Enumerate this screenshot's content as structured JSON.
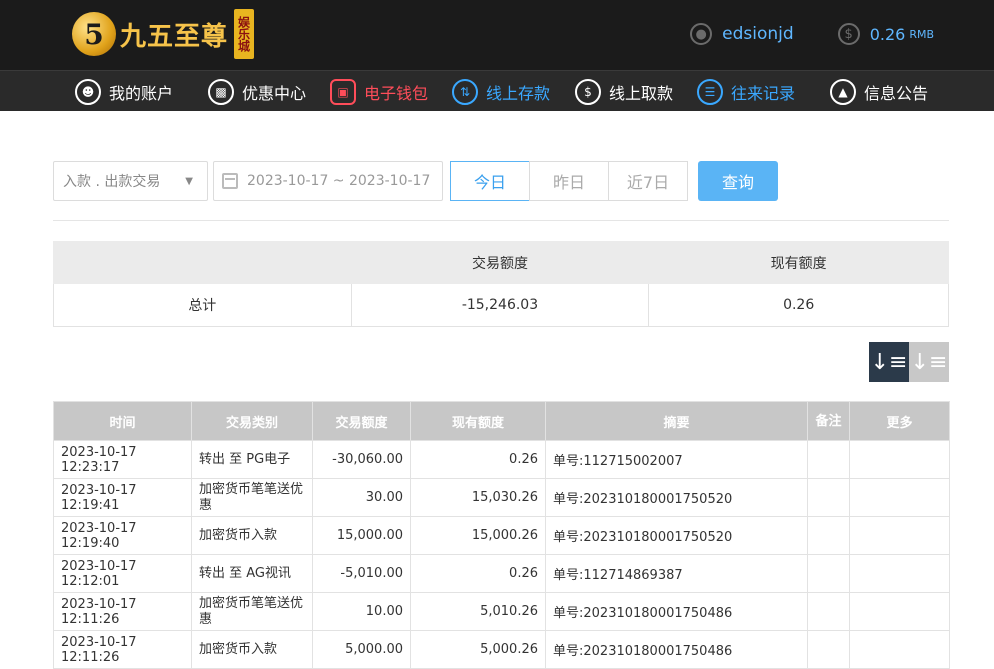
{
  "header": {
    "logo_text": "九五至尊",
    "logo_badge": "5",
    "logo_tag": "娱乐城",
    "username": "edsionjd",
    "balance": "0.26",
    "balance_unit": "RMB",
    "icons": {
      "user": "user-icon",
      "coin": "dollar-coin-icon"
    }
  },
  "nav": {
    "items": [
      {
        "label": "我的账户",
        "icon": "user-circle-icon"
      },
      {
        "label": "优惠中心",
        "icon": "gift-icon"
      },
      {
        "label": "电子钱包",
        "icon": "wallet-icon",
        "color": "#ff4d5a"
      },
      {
        "label": "线上存款",
        "icon": "deposit-icon",
        "color": "#3aa8ff"
      },
      {
        "label": "线上取款",
        "icon": "withdraw-icon"
      },
      {
        "label": "往来记录",
        "icon": "records-icon",
        "color": "#3aa8ff"
      },
      {
        "label": "信息公告",
        "icon": "bell-icon"
      }
    ]
  },
  "filters": {
    "type_select": "入款 . 出款交易",
    "date_range": "2023-10-17 ~ 2023-10-17",
    "today": "今日",
    "yesterday": "昨日",
    "last7": "近7日",
    "query": "查询"
  },
  "summary": {
    "headers": [
      "",
      "交易额度",
      "现有额度"
    ],
    "row": [
      "总计",
      "-15,246.03",
      "0.26"
    ]
  },
  "detail": {
    "headers": [
      "时间",
      "交易类别",
      "交易额度",
      "现有额度",
      "摘要",
      "备注",
      "更多"
    ],
    "rows": [
      [
        "2023-10-17 12:23:17",
        "转出 至 PG电子",
        "-30,060.00",
        "0.26",
        "单号:112715002007",
        "",
        ""
      ],
      [
        "2023-10-17 12:19:41",
        "加密货币笔笔送优惠",
        "30.00",
        "15,030.26",
        "单号:202310180001750520",
        "",
        ""
      ],
      [
        "2023-10-17 12:19:40",
        "加密货币入款",
        "15,000.00",
        "15,000.26",
        "单号:202310180001750520",
        "",
        ""
      ],
      [
        "2023-10-17 12:12:01",
        "转出 至 AG视讯",
        "-5,010.00",
        "0.26",
        "单号:112714869387",
        "",
        ""
      ],
      [
        "2023-10-17 12:11:26",
        "加密货币笔笔送优惠",
        "10.00",
        "5,010.26",
        "单号:202310180001750486",
        "",
        ""
      ],
      [
        "2023-10-17 12:11:26",
        "加密货币入款",
        "5,000.00",
        "5,000.26",
        "单号:202310180001750486",
        "",
        ""
      ]
    ]
  },
  "colors": {
    "accent": "#5ab4f5",
    "link": "#3aa8ff",
    "wallet": "#ff4d5a",
    "header_bg": "#1b1b1b"
  }
}
